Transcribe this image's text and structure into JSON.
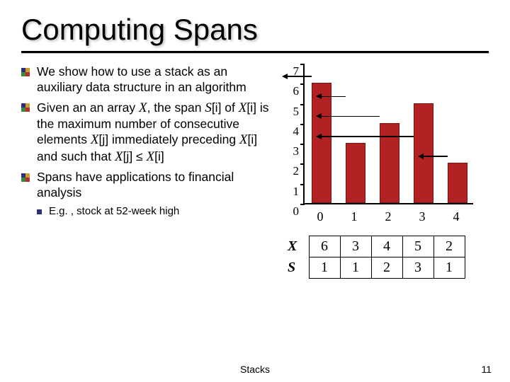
{
  "title": "Computing Spans",
  "bullets": {
    "b1": "We show how to use a stack as an auxiliary data structure in an algorithm",
    "b2_pre": "Given an an array ",
    "b2_X": "X",
    "b2_mid1": ", the span ",
    "b2_Si": "S",
    "b2_ib1": "[i]",
    "b2_of": " of ",
    "b2_Xi": "X",
    "b2_ib2": "[i]",
    "b2_mid2": " is the maximum number of consecutive elements ",
    "b2_Xj": "X",
    "b2_jb": "[j]",
    "b2_mid3": " immediately preceding ",
    "b2_Xi2": "X",
    "b2_ib3": "[i]",
    "b2_mid4": " and such that ",
    "b2_Xj2": "X",
    "b2_jb2": "[j]",
    "b2_le": " ≤ ",
    "b2_Xi3": "X",
    "b2_ib4": "[i]",
    "b3": "Spans have applications to financial analysis",
    "sub": "E.g. , stock at 52-week high"
  },
  "chart_data": {
    "type": "bar",
    "categories": [
      "0",
      "1",
      "2",
      "3",
      "4"
    ],
    "values": [
      6,
      3,
      4,
      5,
      2
    ],
    "ylim": [
      0,
      7
    ],
    "yticks": [
      "0",
      "1",
      "2",
      "3",
      "4",
      "5",
      "6",
      "7"
    ],
    "arrows": [
      {
        "from_bar": 0,
        "at_y": 6.3,
        "span": 1
      },
      {
        "from_bar": 1,
        "at_y": 5.3,
        "span": 1
      },
      {
        "from_bar": 2,
        "at_y": 4.3,
        "span": 2
      },
      {
        "from_bar": 3,
        "at_y": 3.3,
        "span": 3
      },
      {
        "from_bar": 4,
        "at_y": 2.3,
        "span": 1
      }
    ]
  },
  "table": {
    "X_label": "X",
    "S_label": "S",
    "X": [
      "6",
      "3",
      "4",
      "5",
      "2"
    ],
    "S": [
      "1",
      "1",
      "2",
      "3",
      "1"
    ]
  },
  "footer_center": "Stacks",
  "footer_right": "11"
}
